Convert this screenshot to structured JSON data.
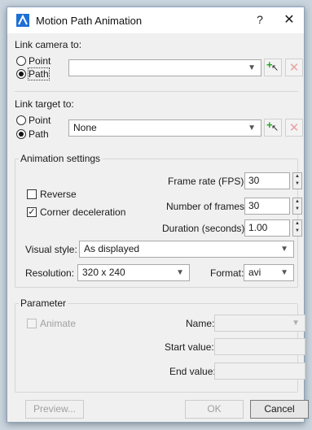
{
  "window": {
    "title": "Motion Path Animation",
    "help": "?",
    "close": "✕",
    "brand_color": "#1e6fd6"
  },
  "camera_group": {
    "title": "Link camera to:",
    "point_label": "Point",
    "path_label": "Path",
    "selected": "Path",
    "combo_value": ""
  },
  "target_group": {
    "title": "Link target to:",
    "point_label": "Point",
    "path_label": "Path",
    "selected": "Path",
    "combo_value": "None"
  },
  "animation": {
    "title": "Animation settings",
    "reverse_label": "Reverse",
    "reverse_checked": false,
    "corner_label": "Corner deceleration",
    "corner_checked": true,
    "fps_label": "Frame rate (FPS):",
    "fps_value": "30",
    "frames_label": "Number of frames:",
    "frames_value": "30",
    "duration_label": "Duration (seconds):",
    "duration_value": "1.00",
    "visual_label": "Visual style:",
    "visual_value": "As displayed",
    "resolution_label": "Resolution:",
    "resolution_value": "320 x 240",
    "format_label": "Format:",
    "format_value": "avi"
  },
  "parameter": {
    "title": "Parameter",
    "animate_label": "Animate",
    "name_label": "Name:",
    "start_label": "Start value:",
    "end_label": "End value:"
  },
  "footer": {
    "preview": "Preview...",
    "ok": "OK",
    "cancel": "Cancel"
  },
  "icons": {
    "pick": "pick-point-icon",
    "delete": "delete-icon",
    "dropdown": "chevron-down-icon"
  }
}
